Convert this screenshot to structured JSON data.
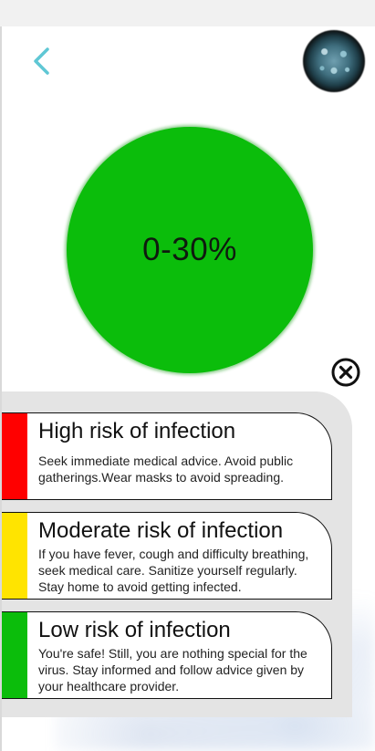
{
  "risk": {
    "value_label": "0-30%",
    "color": "#0bbd0b"
  },
  "icons": {
    "back": "chevron-left-icon",
    "close": "close-circle-icon",
    "avatar": "virus-image"
  },
  "levels": [
    {
      "title": "High risk of infection",
      "description": "Seek immediate medical advice. Avoid public gatherings.Wear masks to avoid spreading.",
      "color": "#ff0000"
    },
    {
      "title": "Moderate risk of infection",
      "description": "If you have fever, cough and difficulty breathing, seek medical care. Sanitize yourself regularly. Stay home to avoid getting infected.",
      "color": "#ffe400"
    },
    {
      "title": "Low risk of infection",
      "description": "You're safe! Still, you are nothing special for the virus. Stay informed and follow advice given by your healthcare provider.",
      "color": "#0bbd0b"
    }
  ]
}
